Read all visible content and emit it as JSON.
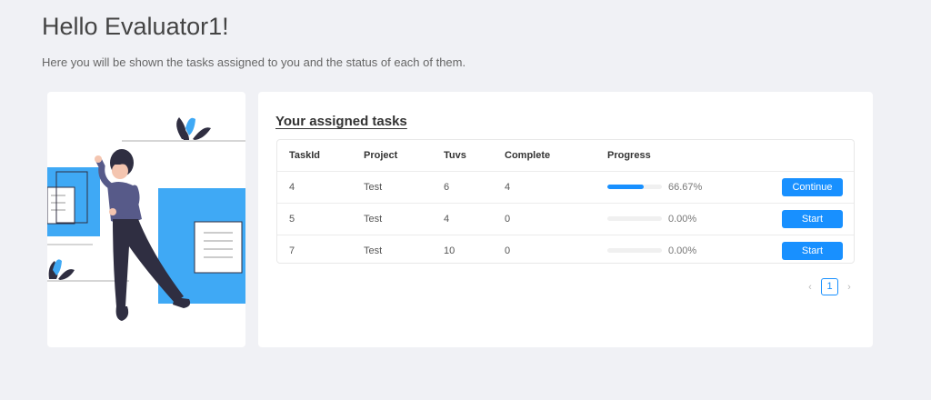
{
  "header": {
    "title": "Hello Evaluator1!",
    "subtitle": "Here you will be shown the tasks assigned to you and the status of each of them."
  },
  "tasks": {
    "heading": "Your assigned tasks",
    "columns": [
      "TaskId",
      "Project",
      "Tuvs",
      "Complete",
      "Progress"
    ],
    "rows": [
      {
        "id": "4",
        "project": "Test",
        "tuvs": "6",
        "complete": "4",
        "progress": 66.67,
        "progress_label": "66.67%",
        "action": "Continue"
      },
      {
        "id": "5",
        "project": "Test",
        "tuvs": "4",
        "complete": "0",
        "progress": 0,
        "progress_label": "0.00%",
        "action": "Start"
      },
      {
        "id": "7",
        "project": "Test",
        "tuvs": "10",
        "complete": "0",
        "progress": 0,
        "progress_label": "0.00%",
        "action": "Start"
      }
    ]
  },
  "pagination": {
    "current_page": "1",
    "prev_icon": "chevron-left-icon",
    "next_icon": "chevron-right-icon"
  },
  "colors": {
    "accent": "#1890ff",
    "illustration_blue": "#3fa9f5",
    "figure_dark": "#2f2e41"
  }
}
